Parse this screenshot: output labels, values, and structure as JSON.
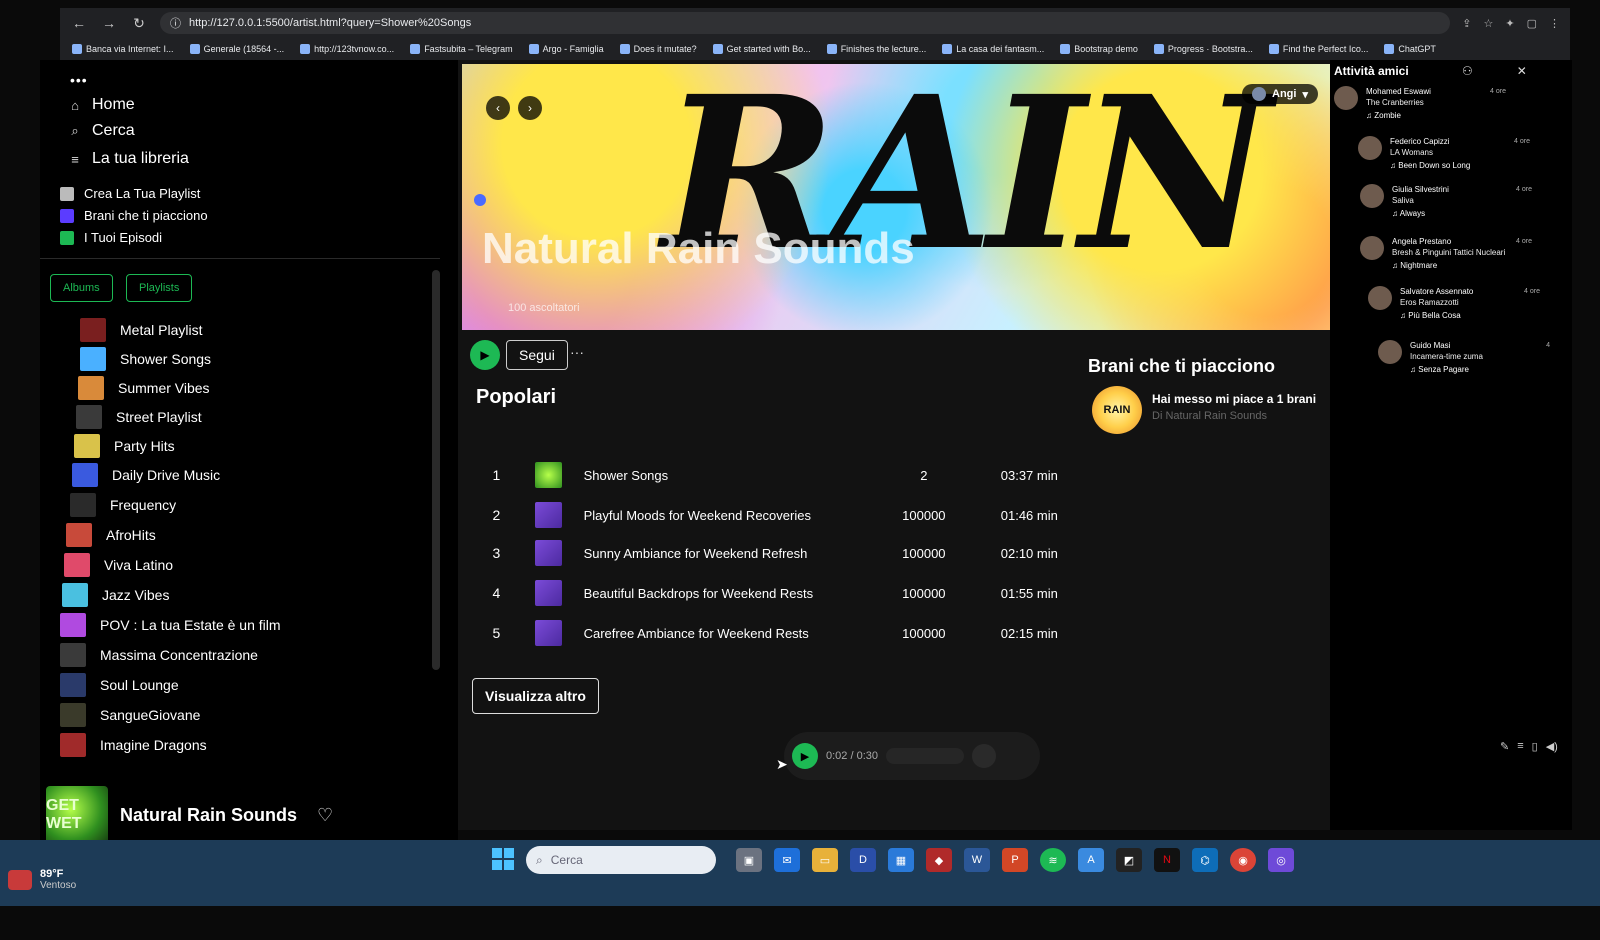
{
  "browser": {
    "url": "http://127.0.0.1:5500/artist.html?query=Shower%20Songs",
    "bookmarks": [
      "Banca via Internet: I...",
      "Generale (18564 -...",
      "http://123tvnow.co...",
      "Fastsubita – Telegram",
      "Argo - Famiglia",
      "Does it mutate?",
      "Get started with Bo...",
      "Finishes the lecture...",
      "La casa dei fantasm...",
      "Bootstrap demo",
      "Progress · Bootstra...",
      "Find the Perfect Ico...",
      "ChatGPT"
    ]
  },
  "sidebar": {
    "nav": [
      {
        "label": "Home",
        "icon": "home-icon"
      },
      {
        "label": "Cerca",
        "icon": "search-icon"
      },
      {
        "label": "La tua libreria",
        "icon": "library-icon"
      }
    ],
    "quick": [
      {
        "label": "Crea La Tua Playlist",
        "color": "#bbbbbb"
      },
      {
        "label": "Brani che ti piacciono",
        "color": "#5b3cff"
      },
      {
        "label": "I Tuoi Episodi",
        "color": "#1DB954"
      }
    ],
    "filters": [
      "Albums",
      "Playlists"
    ],
    "playlists": [
      {
        "label": "Metal Playlist",
        "color": "#7a1f1f"
      },
      {
        "label": "Shower Songs",
        "color": "#4ab0ff"
      },
      {
        "label": "Summer Vibes",
        "color": "#d98a3a"
      },
      {
        "label": "Street Playlist",
        "color": "#3a3a3a"
      },
      {
        "label": "Party Hits",
        "color": "#d9c24a"
      },
      {
        "label": "Daily Drive Music",
        "color": "#3a5adf"
      },
      {
        "label": "Frequency",
        "color": "#2a2a2a"
      },
      {
        "label": "AfroHits",
        "color": "#c84a3a"
      },
      {
        "label": "Viva Latino",
        "color": "#e04a6a"
      },
      {
        "label": "Jazz Vibes",
        "color": "#4ac0e0"
      },
      {
        "label": "POV : La tua Estate è un film",
        "color": "#b04ae0"
      },
      {
        "label": "Massima Concentrazione",
        "color": "#3a3a3a"
      },
      {
        "label": "Soul Lounge",
        "color": "#2a3a6a"
      },
      {
        "label": "SangueGiovane",
        "color": "#3a3a2a"
      },
      {
        "label": "Imagine Dragons",
        "color": "#a02a2a"
      }
    ],
    "now_playing": {
      "title": "Natural Rain Sounds",
      "art_text": "GET WET"
    }
  },
  "main": {
    "banner": {
      "big_text": "RAIN",
      "artist": "Natural Rain Sounds",
      "listeners": "100 ascoltatori",
      "user": "Angi"
    },
    "follow_label": "Segui",
    "more_dots": "···",
    "popular_title": "Popolari",
    "tracks": [
      {
        "num": "1",
        "title": "Shower Songs",
        "plays": "2",
        "duration": "03:37 min"
      },
      {
        "num": "2",
        "title": "Playful Moods for Weekend Recoveries",
        "plays": "100000",
        "duration": "01:46 min"
      },
      {
        "num": "3",
        "title": "Sunny Ambiance for Weekend Refresh",
        "plays": "100000",
        "duration": "02:10 min"
      },
      {
        "num": "4",
        "title": "Beautiful Backdrops for Weekend Rests",
        "plays": "100000",
        "duration": "01:55 min"
      },
      {
        "num": "5",
        "title": "Carefree Ambiance for Weekend Rests",
        "plays": "100000",
        "duration": "02:15 min"
      }
    ],
    "show_more": "Visualizza altro",
    "liked": {
      "title": "Brani che ti piacciono",
      "line": "Hai messo mi piace a 1 brani",
      "sub": "Di Natural Rain Sounds",
      "art_text": "RAIN"
    },
    "player": {
      "time": "0:02 / 0:30"
    }
  },
  "friends": {
    "title": "Attività amici",
    "list": [
      {
        "name": "Mohamed Eswawi",
        "artist": "The Cranberries",
        "track": "Zombie",
        "time": "4 ore"
      },
      {
        "name": "Federico Capizzi",
        "artist": "LA Womans",
        "track": "Been Down so Long",
        "time": "4 ore"
      },
      {
        "name": "Giulia Silvestrini",
        "artist": "Saliva",
        "track": "Always",
        "time": "4 ore"
      },
      {
        "name": "Angela Prestano",
        "artist": "Bresh & Pinguini Tattici Nucleari",
        "track": "Nightmare",
        "time": "4 ore"
      },
      {
        "name": "Salvatore Assennato",
        "artist": "Eros Ramazzotti",
        "track": "Più Bella Cosa",
        "time": "4 ore"
      },
      {
        "name": "Guido Masi",
        "artist": "Incamera-time zuma",
        "track": "Senza Pagare",
        "time": "4"
      }
    ]
  },
  "taskbar": {
    "search_placeholder": "Cerca",
    "weather_temp": "89°F",
    "weather_desc": "Ventoso"
  }
}
